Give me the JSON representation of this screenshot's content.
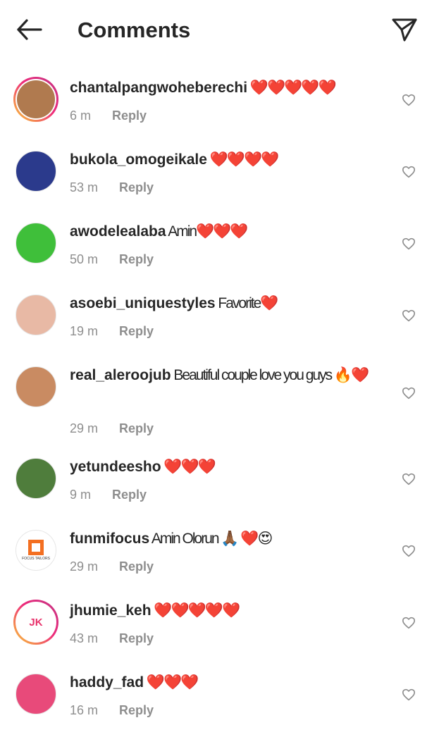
{
  "header": {
    "title": "Comments",
    "back_icon": "arrow-left-icon",
    "send_icon": "paper-plane-icon"
  },
  "comments": [
    {
      "username": "chantalpangwoheberechi",
      "text": " ❤️❤️❤️❤️❤️",
      "time": "6 m",
      "reply": "Reply",
      "avatar_ring": true,
      "avatar_color": "#b07a4f"
    },
    {
      "username": "bukola_omogeikale",
      "text": " ❤️❤️❤️❤️",
      "time": "53 m",
      "reply": "Reply",
      "avatar_ring": false,
      "avatar_color": "#2b3a8c"
    },
    {
      "username": "awodelealaba",
      "text": " Amin❤️❤️❤️",
      "time": "50 m",
      "reply": "Reply",
      "avatar_ring": false,
      "avatar_color": "#3fbf3a"
    },
    {
      "username": "asoebi_uniquestyles",
      "text": " Favorite❤️",
      "time": "19 m",
      "reply": "Reply",
      "avatar_ring": false,
      "avatar_color": "#e8b9a5"
    },
    {
      "username": "real_aleroojub",
      "text": " Beautiful couple love you guys 🔥❤️",
      "time": "29 m",
      "reply": "Reply",
      "avatar_ring": false,
      "avatar_color": "#c98b62"
    },
    {
      "username": "yetundeesho",
      "text": " ❤️❤️❤️",
      "time": "9 m",
      "reply": "Reply",
      "avatar_ring": false,
      "avatar_color": "#4f7d3c"
    },
    {
      "username": "funmifocus",
      "text": " Amin Olorun 🙏🏾 ❤️😍",
      "time": "29 m",
      "reply": "Reply",
      "avatar_ring": false,
      "avatar_color": "#f36f21",
      "avatar_caption": "FOCUS TAILORS"
    },
    {
      "username": "jhumie_keh",
      "text": " ❤️❤️❤️❤️❤️",
      "time": "43 m",
      "reply": "Reply",
      "avatar_ring": true,
      "avatar_color": "#ffffff",
      "avatar_letters": "JK"
    },
    {
      "username": "haddy_fad",
      "text": " ❤️❤️❤️",
      "time": "16 m",
      "reply": "Reply",
      "avatar_ring": false,
      "avatar_color": "#e84a7a"
    }
  ],
  "icons": {
    "like": "heart-outline-icon"
  }
}
